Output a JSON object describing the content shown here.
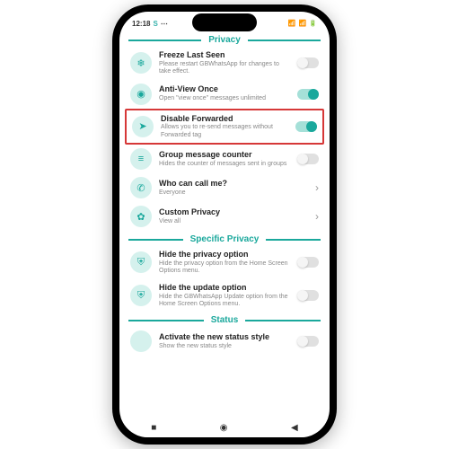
{
  "status": {
    "time": "12:18",
    "indicator": "S",
    "wifi": "▲",
    "signal": "▮",
    "battery": "▢"
  },
  "sections": [
    {
      "title": "Privacy",
      "items": [
        {
          "icon": "❄",
          "title": "Freeze Last Seen",
          "sub": "Please restart GBWhatsApp for changes to take effect.",
          "control": "toggle-off"
        },
        {
          "icon": "◉",
          "title": "Anti-View Once",
          "sub": "Open \"view once\" messages unlimited",
          "control": "toggle-on"
        },
        {
          "icon": "➤",
          "title": "Disable Forwarded",
          "sub": "Allows you to re-send messages without Forwarded tag",
          "control": "toggle-on",
          "highlighted": true
        },
        {
          "icon": "≡",
          "title": "Group message counter",
          "sub": "Hides the counter of messages sent in groups",
          "control": "toggle-off"
        },
        {
          "icon": "✆",
          "title": "Who can call me?",
          "sub": "Everyone",
          "control": "chevron"
        },
        {
          "icon": "✿",
          "title": "Custom Privacy",
          "sub": "View all",
          "control": "chevron"
        }
      ]
    },
    {
      "title": "Specific Privacy",
      "items": [
        {
          "icon": "⛨",
          "title": "Hide the privacy option",
          "sub": "Hide the privacy option from the Home Screen Options menu.",
          "control": "toggle-off"
        },
        {
          "icon": "⛨",
          "title": "Hide the update option",
          "sub": "Hide the GBWhatsApp Update option from the Home Screen Options menu.",
          "control": "toggle-off"
        }
      ]
    },
    {
      "title": "Status",
      "items": [
        {
          "icon": "",
          "title": "Activate the new status style",
          "sub": "Show the new status style",
          "control": "toggle-off"
        }
      ]
    }
  ],
  "nav": {
    "back": "■",
    "home": "◉",
    "recent": "◀"
  }
}
